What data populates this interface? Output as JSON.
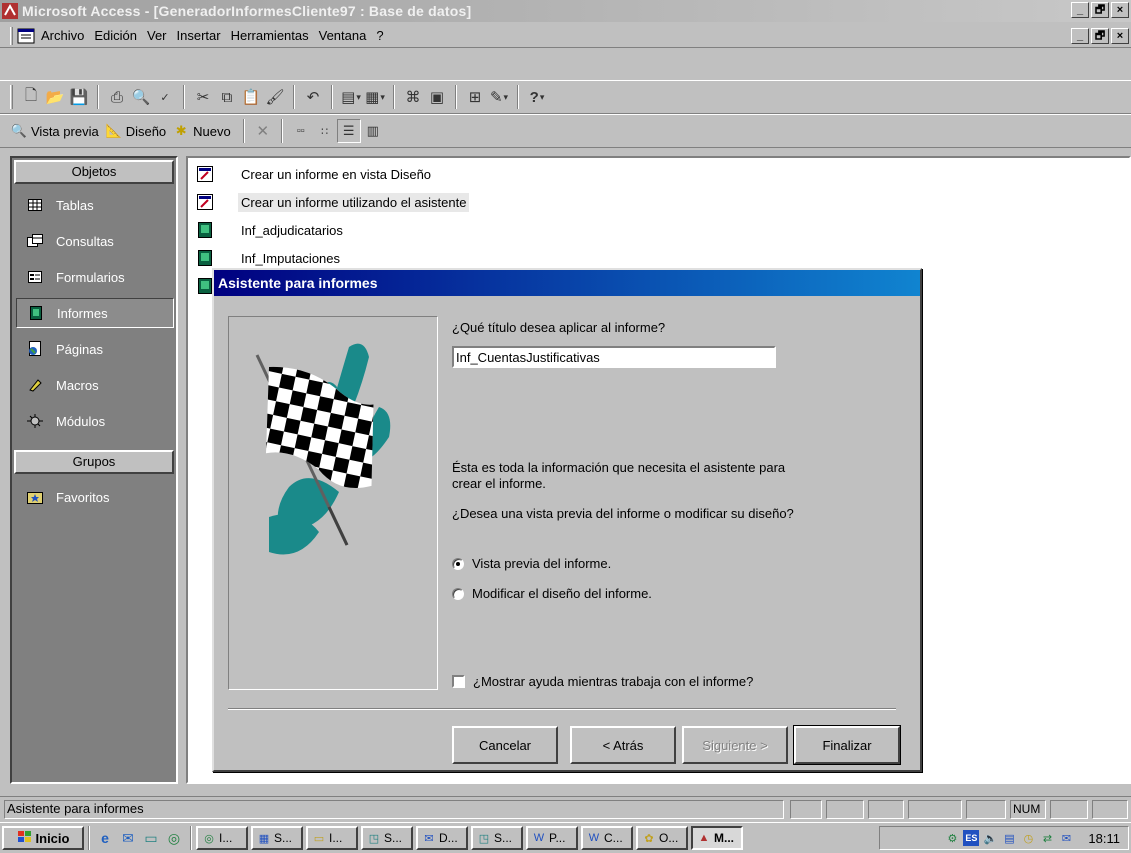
{
  "window": {
    "title": "Microsoft Access - [GeneradorInformesCliente97 : Base de datos]",
    "caption_buttons": [
      "_",
      "🗗",
      "×"
    ]
  },
  "menu": {
    "items": [
      "Archivo",
      "Edición",
      "Ver",
      "Insertar",
      "Herramientas",
      "Ventana",
      "?"
    ]
  },
  "toolbar": {
    "buttons": [
      "new-icon",
      "open-icon",
      "save-icon",
      "print-icon",
      "print-preview-icon",
      "spelling-icon",
      "cut-icon",
      "copy-icon",
      "paste-icon",
      "format-painter-icon",
      "undo-icon",
      "office-links-icon",
      "analyze-icon",
      "code-icon",
      "properties-icon",
      "relationships-icon",
      "new-object-icon",
      "help-icon"
    ]
  },
  "db_toolbar": {
    "preview": "Vista previa",
    "design": "Diseño",
    "new": "Nuevo"
  },
  "objects_bar": {
    "header": "Objetos",
    "items": [
      "Tablas",
      "Consultas",
      "Formularios",
      "Informes",
      "Páginas",
      "Macros",
      "Módulos"
    ],
    "selected": "Informes",
    "groups_header": "Grupos",
    "groups": [
      "Favoritos"
    ]
  },
  "report_list": [
    "Crear un informe en vista Diseño",
    "Crear un informe utilizando el asistente",
    "Inf_adjudicatarios",
    "Inf_Imputaciones"
  ],
  "dialog": {
    "title": "Asistente para informes",
    "question": "¿Qué título desea aplicar al informe?",
    "title_value": "Inf_CuentasJustificativas",
    "info_line1": "Ésta es toda la información que necesita el asistente para",
    "info_line2": "crear el informe.",
    "choice_question": "¿Desea una vista previa del informe o modificar su diseño?",
    "option_preview": "Vista previa del informe.",
    "option_modify": "Modificar el diseño del informe.",
    "selected_option": "preview",
    "help_checkbox": "¿Mostrar ayuda mientras trabaja con el informe?",
    "help_checked": false,
    "buttons": {
      "cancel": "Cancelar",
      "back": "< Atrás",
      "next": "Siguiente >",
      "finish": "Finalizar"
    }
  },
  "status": {
    "text": "Asistente para informes",
    "num": "NUM"
  },
  "taskbar": {
    "start": "Inicio",
    "tasks": [
      "I...",
      "S...",
      "I...",
      "S...",
      "D...",
      "S...",
      "P...",
      "C...",
      "O...",
      "M..."
    ],
    "clock": "18:11",
    "lang": "ES"
  }
}
